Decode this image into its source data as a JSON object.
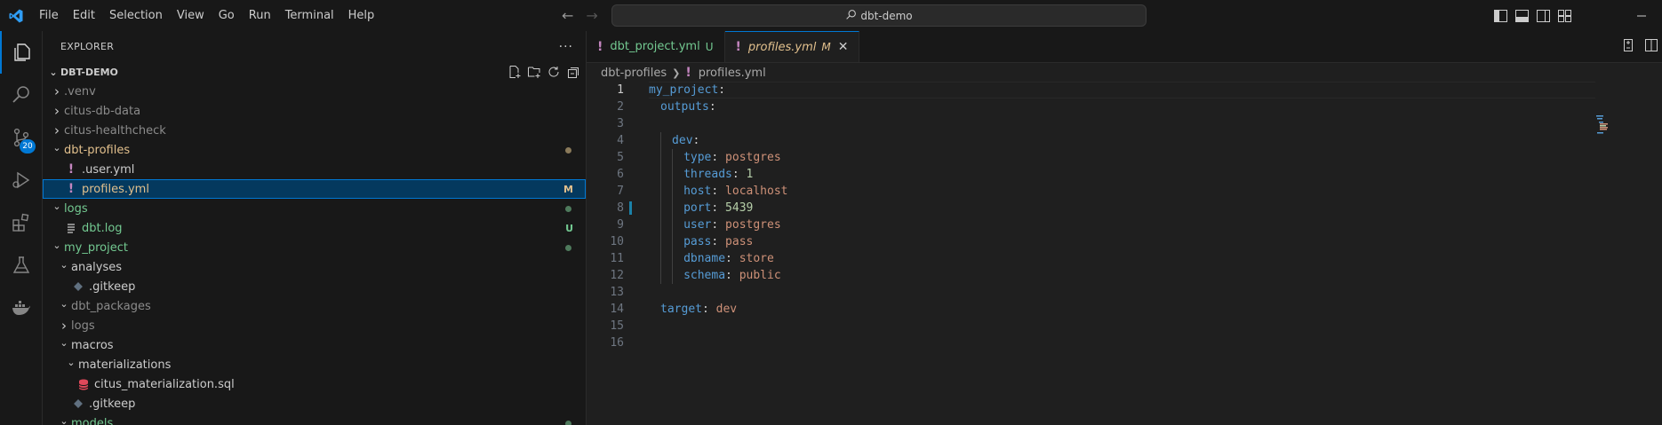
{
  "menu": [
    "File",
    "Edit",
    "Selection",
    "View",
    "Go",
    "Run",
    "Terminal",
    "Help"
  ],
  "search": {
    "text": "dbt-demo"
  },
  "activity": {
    "scm_badge": "20"
  },
  "explorer": {
    "title": "EXPLORER",
    "more": "···",
    "section": "DBT-DEMO",
    "tree": [
      {
        "label": ".venv",
        "indent": 1,
        "chevron": "right",
        "color": "#8b8b8b",
        "icon": "",
        "deco": ""
      },
      {
        "label": "citus-db-data",
        "indent": 1,
        "chevron": "right",
        "color": "#8b8b8b",
        "icon": "",
        "deco": ""
      },
      {
        "label": "citus-healthcheck",
        "indent": 1,
        "chevron": "right",
        "color": "#8b8b8b",
        "icon": "",
        "deco": ""
      },
      {
        "label": "dbt-profiles",
        "indent": 1,
        "chevron": "down",
        "color": "#e2c08d",
        "icon": "",
        "deco": "dot",
        "deco_color": "#8a7a5a"
      },
      {
        "label": ".user.yml",
        "indent": 2,
        "chevron": "",
        "color": "#cccccc",
        "icon": "yaml",
        "deco": ""
      },
      {
        "label": "profiles.yml",
        "indent": 2,
        "chevron": "",
        "color": "#e2c08d",
        "icon": "yaml",
        "deco": "M",
        "deco_color": "#e2c08d",
        "selected": true
      },
      {
        "label": "logs",
        "indent": 1,
        "chevron": "down",
        "color": "#73c991",
        "icon": "",
        "deco": "dot",
        "deco_color": "#4e7a5c"
      },
      {
        "label": "dbt.log",
        "indent": 2,
        "chevron": "",
        "color": "#73c991",
        "icon": "log",
        "deco": "U",
        "deco_color": "#73c991"
      },
      {
        "label": "my_project",
        "indent": 1,
        "chevron": "down",
        "color": "#73c991",
        "icon": "",
        "deco": "dot",
        "deco_color": "#4e7a5c"
      },
      {
        "label": "analyses",
        "indent": 2,
        "chevron": "down",
        "color": "#cccccc",
        "icon": "",
        "deco": ""
      },
      {
        "label": ".gitkeep",
        "indent": 3,
        "chevron": "",
        "color": "#cccccc",
        "icon": "git",
        "deco": ""
      },
      {
        "label": "dbt_packages",
        "indent": 2,
        "chevron": "down",
        "color": "#8b8b8b",
        "icon": "",
        "deco": ""
      },
      {
        "label": "logs",
        "indent": 2,
        "chevron": "right",
        "color": "#8b8b8b",
        "icon": "",
        "deco": ""
      },
      {
        "label": "macros",
        "indent": 2,
        "chevron": "down",
        "color": "#cccccc",
        "icon": "",
        "deco": ""
      },
      {
        "label": "materializations",
        "indent": 3,
        "chevron": "down",
        "color": "#cccccc",
        "icon": "",
        "deco": ""
      },
      {
        "label": "citus_materialization.sql",
        "indent": 4,
        "chevron": "",
        "color": "#cccccc",
        "icon": "db",
        "deco": ""
      },
      {
        "label": ".gitkeep",
        "indent": 3,
        "chevron": "",
        "color": "#cccccc",
        "icon": "git",
        "deco": ""
      },
      {
        "label": "models",
        "indent": 2,
        "chevron": "down",
        "color": "#73c991",
        "icon": "",
        "deco": "dot",
        "deco_color": "#4e7a5c"
      }
    ]
  },
  "tabs": [
    {
      "label": "dbt_project.yml",
      "status": "U",
      "active": false
    },
    {
      "label": "profiles.yml",
      "status": "M",
      "active": true
    }
  ],
  "breadcrumb": {
    "folder": "dbt-profiles",
    "file": "profiles.yml"
  },
  "code": [
    {
      "n": "1",
      "indent": 0,
      "tokens": [
        [
          "key",
          "my_project"
        ],
        [
          "colon",
          ":"
        ]
      ]
    },
    {
      "n": "2",
      "indent": 1,
      "tokens": [
        [
          "key",
          "outputs"
        ],
        [
          "colon",
          ":"
        ]
      ]
    },
    {
      "n": "3",
      "indent": 0,
      "tokens": []
    },
    {
      "n": "4",
      "indent": 2,
      "tokens": [
        [
          "key",
          "dev"
        ],
        [
          "colon",
          ":"
        ]
      ]
    },
    {
      "n": "5",
      "indent": 3,
      "tokens": [
        [
          "key",
          "type"
        ],
        [
          "colon",
          ": "
        ],
        [
          "str",
          "postgres"
        ]
      ]
    },
    {
      "n": "6",
      "indent": 3,
      "tokens": [
        [
          "key",
          "threads"
        ],
        [
          "colon",
          ": "
        ],
        [
          "num",
          "1"
        ]
      ]
    },
    {
      "n": "7",
      "indent": 3,
      "tokens": [
        [
          "key",
          "host"
        ],
        [
          "colon",
          ": "
        ],
        [
          "str",
          "localhost"
        ]
      ]
    },
    {
      "n": "8",
      "indent": 3,
      "tokens": [
        [
          "key",
          "port"
        ],
        [
          "colon",
          ": "
        ],
        [
          "num",
          "5439"
        ]
      ]
    },
    {
      "n": "9",
      "indent": 3,
      "tokens": [
        [
          "key",
          "user"
        ],
        [
          "colon",
          ": "
        ],
        [
          "str",
          "postgres"
        ]
      ]
    },
    {
      "n": "10",
      "indent": 3,
      "tokens": [
        [
          "key",
          "pass"
        ],
        [
          "colon",
          ": "
        ],
        [
          "str",
          "pass"
        ]
      ]
    },
    {
      "n": "11",
      "indent": 3,
      "tokens": [
        [
          "key",
          "dbname"
        ],
        [
          "colon",
          ": "
        ],
        [
          "str",
          "store"
        ]
      ]
    },
    {
      "n": "12",
      "indent": 3,
      "tokens": [
        [
          "key",
          "schema"
        ],
        [
          "colon",
          ": "
        ],
        [
          "str",
          "public"
        ]
      ]
    },
    {
      "n": "13",
      "indent": 0,
      "tokens": []
    },
    {
      "n": "14",
      "indent": 1,
      "tokens": [
        [
          "key",
          "target"
        ],
        [
          "colon",
          ": "
        ],
        [
          "str",
          "dev"
        ]
      ]
    },
    {
      "n": "15",
      "indent": 0,
      "tokens": []
    },
    {
      "n": "16",
      "indent": 0,
      "tokens": []
    }
  ]
}
